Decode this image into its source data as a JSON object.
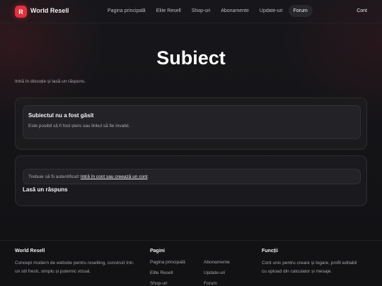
{
  "brand": {
    "logo_letter": "R",
    "name": "World Resell",
    "accent": "#e0323d"
  },
  "nav": {
    "items": [
      {
        "label": "Pagina principală"
      },
      {
        "label": "Elite Resell"
      },
      {
        "label": "Shop-uri"
      },
      {
        "label": "Abonamente"
      },
      {
        "label": "Update-uri"
      },
      {
        "label": "Forum",
        "active": true
      }
    ],
    "account_label": "Cont"
  },
  "page": {
    "title": "Subiect",
    "subtitle": "Intră în discuție și lasă un răspuns."
  },
  "error_card": {
    "title": "Subiectul nu a fost găsit",
    "text": "Este posibil să fi fost șters sau linkul să fie invalid."
  },
  "reply": {
    "auth_prefix": "Trebuie să fii autentificat! ",
    "auth_link": "Intră în cont sau creează un cont",
    "auth_suffix": ".",
    "title": "Lasă un răspuns"
  },
  "footer": {
    "about_title": "World Resell",
    "about_text_1": "Concept modern de website pentru reselling, construit într-",
    "about_text_2": "un stil fresh, simplu și puternic vizual.",
    "pages_title": "Pagini",
    "pages_col1": [
      "Pagina principală",
      "Elite Resell",
      "Shop-uri"
    ],
    "pages_col2": [
      "Abonamente",
      "Update-uri",
      "Forum"
    ],
    "functions_title": "Funcții",
    "functions_text_1": "Cont unic pentru creare și logare, profil editabil",
    "functions_text_2": "cu upload din calculator și mesaje."
  }
}
